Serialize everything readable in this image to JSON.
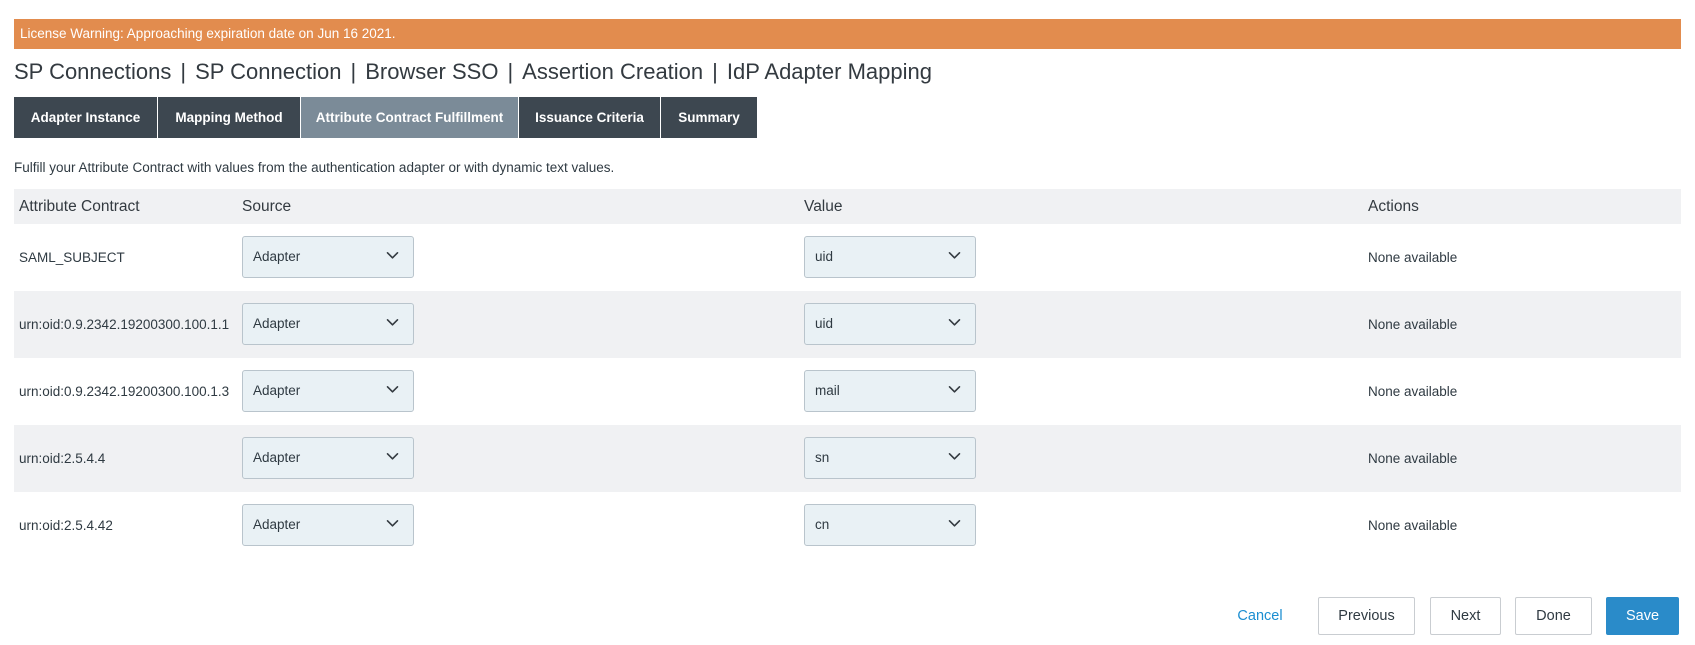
{
  "license_warning": "License Warning: Approaching expiration date on Jun 16 2021.",
  "breadcrumb": [
    "SP Connections",
    "SP Connection",
    "Browser SSO",
    "Assertion Creation",
    "IdP Adapter Mapping"
  ],
  "breadcrumb_separator": "|",
  "tabs": [
    {
      "label": "Adapter Instance",
      "active": false
    },
    {
      "label": "Mapping Method",
      "active": false
    },
    {
      "label": "Attribute Contract Fulfillment",
      "active": true
    },
    {
      "label": "Issuance Criteria",
      "active": false
    },
    {
      "label": "Summary",
      "active": false
    }
  ],
  "description": "Fulfill your Attribute Contract with values from the authentication adapter or with dynamic text values.",
  "table": {
    "headers": {
      "attribute_contract": "Attribute Contract",
      "source": "Source",
      "value": "Value",
      "actions": "Actions"
    },
    "rows": [
      {
        "attribute": "SAML_SUBJECT",
        "source": "Adapter",
        "value": "uid",
        "actions": "None available"
      },
      {
        "attribute": "urn:oid:0.9.2342.19200300.100.1.1",
        "source": "Adapter",
        "value": "uid",
        "actions": "None available"
      },
      {
        "attribute": "urn:oid:0.9.2342.19200300.100.1.3",
        "source": "Adapter",
        "value": "mail",
        "actions": "None available"
      },
      {
        "attribute": "urn:oid:2.5.4.4",
        "source": "Adapter",
        "value": "sn",
        "actions": "None available"
      },
      {
        "attribute": "urn:oid:2.5.4.42",
        "source": "Adapter",
        "value": "cn",
        "actions": "None available"
      }
    ]
  },
  "footer": {
    "cancel": "Cancel",
    "previous": "Previous",
    "next": "Next",
    "done": "Done",
    "save": "Save"
  },
  "colors": {
    "warning_bg": "#e28c4e",
    "tab_bg": "#3d4750",
    "tab_active_bg": "#7b8b98",
    "link": "#1b8ed1",
    "primary_button": "#2a8bc9"
  }
}
